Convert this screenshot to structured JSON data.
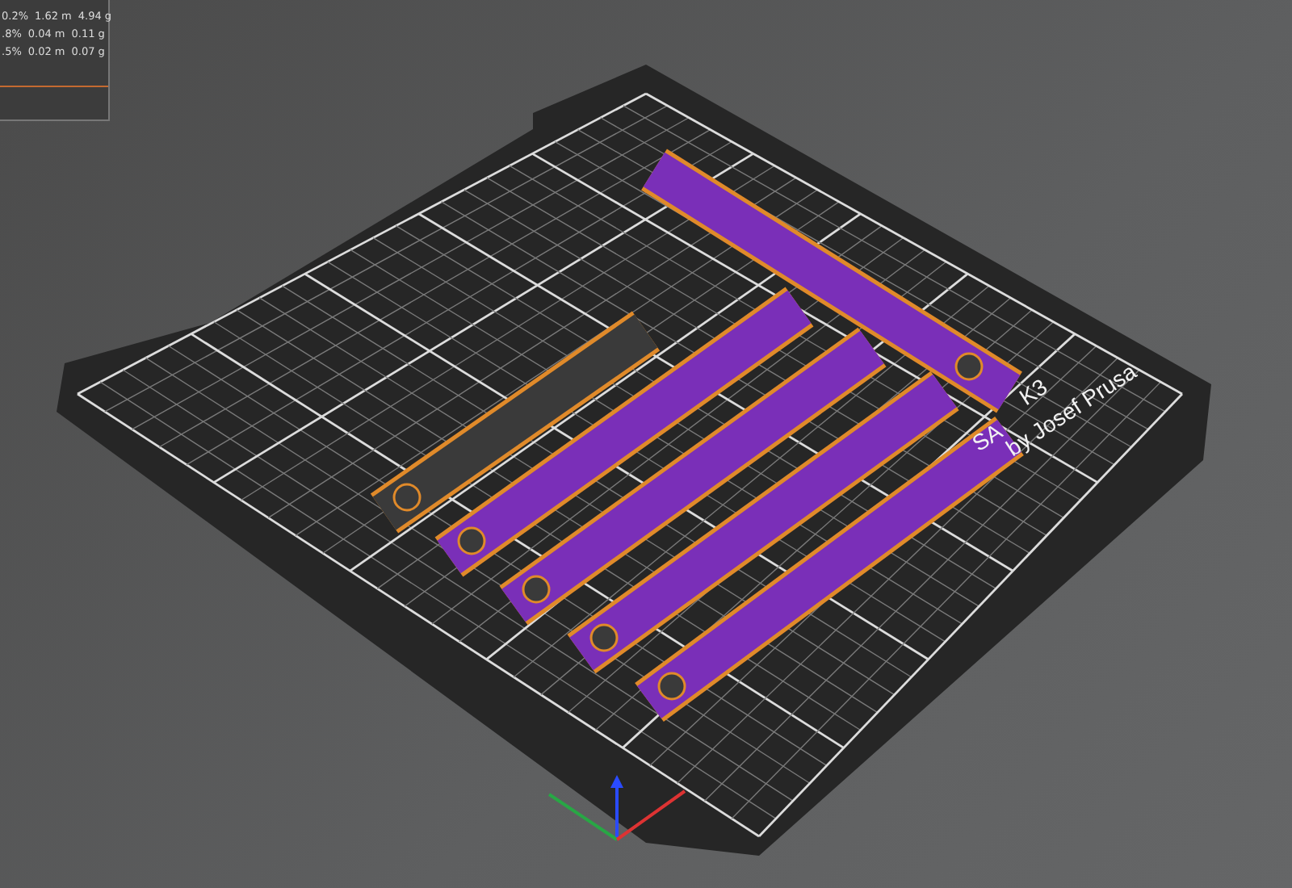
{
  "legend": {
    "rows": [
      {
        "share": "0.2%",
        "length": "1.62 m",
        "weight": "4.94 g"
      },
      {
        "share": ".8%",
        "length": "0.04 m",
        "weight": "0.11 g"
      },
      {
        "share": ".5%",
        "length": "0.02 m",
        "weight": "0.07 g"
      }
    ]
  },
  "bed_logo": {
    "parts": [
      "SA",
      "K3"
    ],
    "byline": "by Josef Prusa"
  }
}
